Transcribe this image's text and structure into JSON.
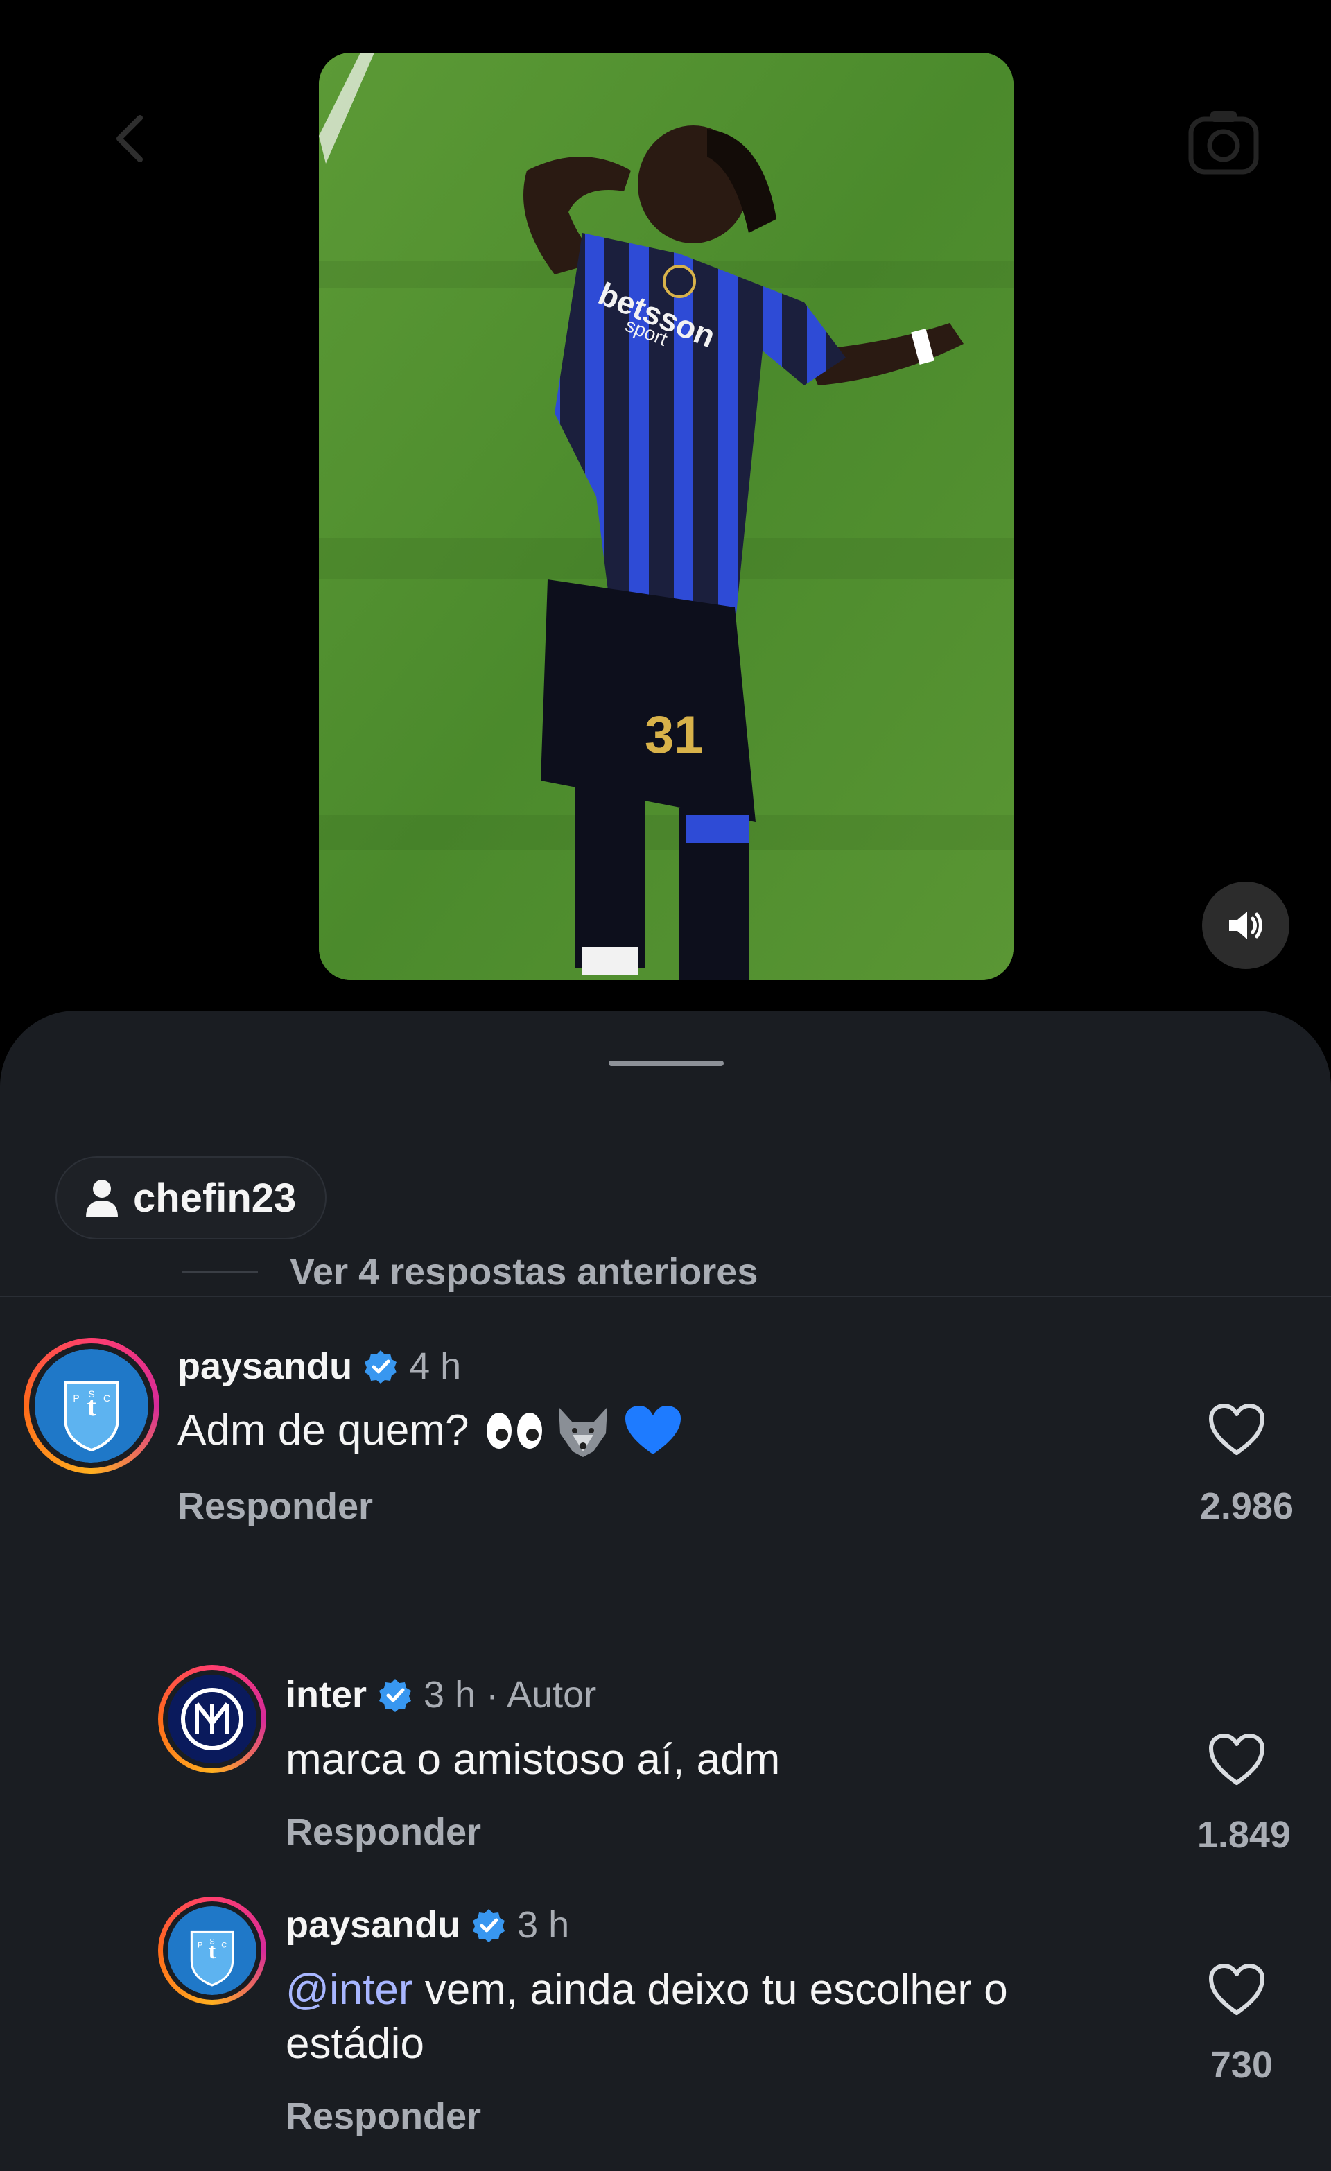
{
  "colors": {
    "background": "#000000",
    "sheet": "#1a1d22",
    "muted_text": "#a9adb4",
    "mention": "#a8b6ff",
    "verified": "#3897f0"
  },
  "video": {
    "sound_icon": "speaker-on-icon"
  },
  "sheet": {
    "user_chip": {
      "icon": "person-icon",
      "label": "chefin23"
    },
    "comments": [
      {
        "username": "paysandu",
        "time": "4 h",
        "text": "Adm de quem? 👀🐺💙",
        "text_plain": "Adm de quem?",
        "reply_label": "Responder",
        "likes": "2.986"
      }
    ],
    "view_more_label": "Ver 4 respostas anteriores",
    "replies": [
      {
        "username": "inter",
        "time": "3 h · Autor",
        "text": "marca o amistoso aí, adm",
        "reply_label": "Responder",
        "likes": "1.849"
      },
      {
        "username": "paysandu",
        "time": "3 h",
        "mention": "@inter",
        "text_line1": " vem, ainda deixo tu escolher o",
        "text_line2": "estádio",
        "reply_label": "Responder",
        "likes": "730"
      }
    ]
  }
}
